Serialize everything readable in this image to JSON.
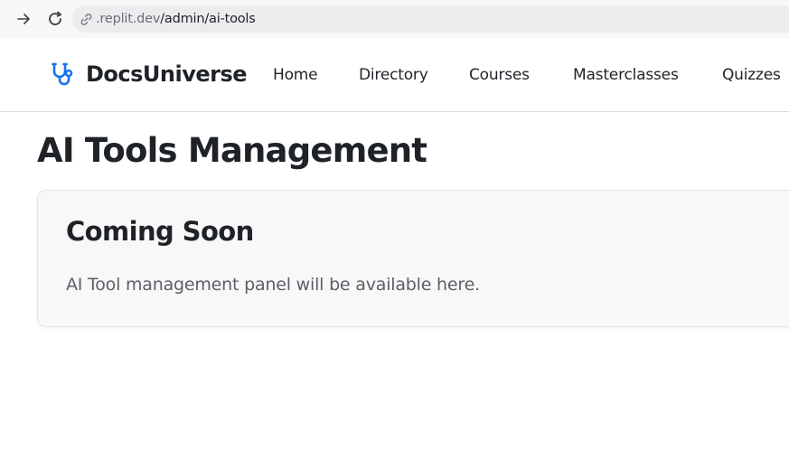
{
  "browser": {
    "url_host": ".replit.dev",
    "url_path": "/admin/ai-tools"
  },
  "header": {
    "brand": "DocsUniverse",
    "brand_color": "#1a73e8",
    "nav": [
      {
        "label": "Home"
      },
      {
        "label": "Directory"
      },
      {
        "label": "Courses"
      },
      {
        "label": "Masterclasses"
      },
      {
        "label": "Quizzes"
      }
    ]
  },
  "main": {
    "title": "AI Tools Management",
    "card": {
      "title": "Coming Soon",
      "body": "AI Tool management panel will be available here."
    }
  },
  "icons": {
    "forward": "arrow-right-icon",
    "reload": "reload-icon",
    "url": "link-icon",
    "logo": "stethoscope-icon"
  }
}
